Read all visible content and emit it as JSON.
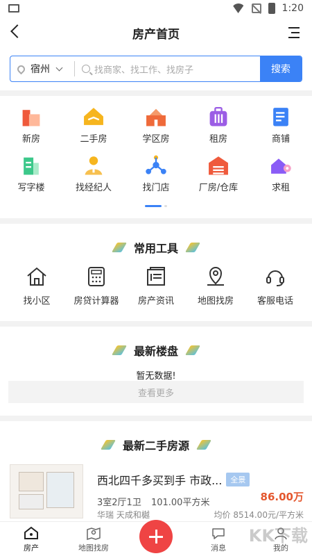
{
  "status": {
    "time": "1:20"
  },
  "header": {
    "title": "房产首页"
  },
  "search": {
    "city": "宿州",
    "placeholder": "找商家、找工作、找房子",
    "button": "搜索"
  },
  "categories": [
    {
      "label": "新房",
      "icon": "buildings-icon",
      "color": "#ef5a3c"
    },
    {
      "label": "二手房",
      "icon": "hand-house-icon",
      "color": "#f6b51e"
    },
    {
      "label": "学区房",
      "icon": "school-icon",
      "color": "#ef6a3a"
    },
    {
      "label": "租房",
      "icon": "suitcase-icon",
      "color": "#9b5de5"
    },
    {
      "label": "商铺",
      "icon": "document-icon",
      "color": "#3b82f6"
    },
    {
      "label": "写字楼",
      "icon": "office-building-icon",
      "color": "#3cc88a"
    },
    {
      "label": "找经纪人",
      "icon": "agent-icon",
      "color": "#f6b51e"
    },
    {
      "label": "找门店",
      "icon": "store-network-icon",
      "color": "#3b82f6"
    },
    {
      "label": "厂房/仓库",
      "icon": "warehouse-icon",
      "color": "#ef5a3c"
    },
    {
      "label": "求租",
      "icon": "house-key-icon",
      "color": "#8a5cf6"
    }
  ],
  "tools": {
    "title": "常用工具",
    "items": [
      {
        "label": "找小区",
        "icon": "house-icon"
      },
      {
        "label": "房贷计算器",
        "icon": "calculator-icon"
      },
      {
        "label": "房产资讯",
        "icon": "news-icon"
      },
      {
        "label": "地图找房",
        "icon": "map-pin-icon"
      },
      {
        "label": "客服电话",
        "icon": "headset-icon"
      }
    ]
  },
  "new_listings": {
    "title": "最新楼盘",
    "empty": "暂无数据!",
    "more": "查看更多"
  },
  "used_listings": {
    "title": "最新二手房源",
    "item": {
      "title": "西北四千多买到手 市政...",
      "tag": "全景",
      "layout": "3室2厅1卫",
      "area": "101.00平方米",
      "price": "86.00万",
      "location": "华瑞 天成和樾",
      "avg_price": "均价 8514.00元/平方米"
    }
  },
  "tabbar": {
    "items": [
      {
        "label": "房产",
        "icon": "home-icon"
      },
      {
        "label": "地图找房",
        "icon": "map-icon"
      },
      {
        "label": "",
        "icon": "plus-icon"
      },
      {
        "label": "消息",
        "icon": "chat-icon"
      },
      {
        "label": "我的",
        "icon": "user-icon"
      }
    ]
  },
  "watermark": "KK下载"
}
